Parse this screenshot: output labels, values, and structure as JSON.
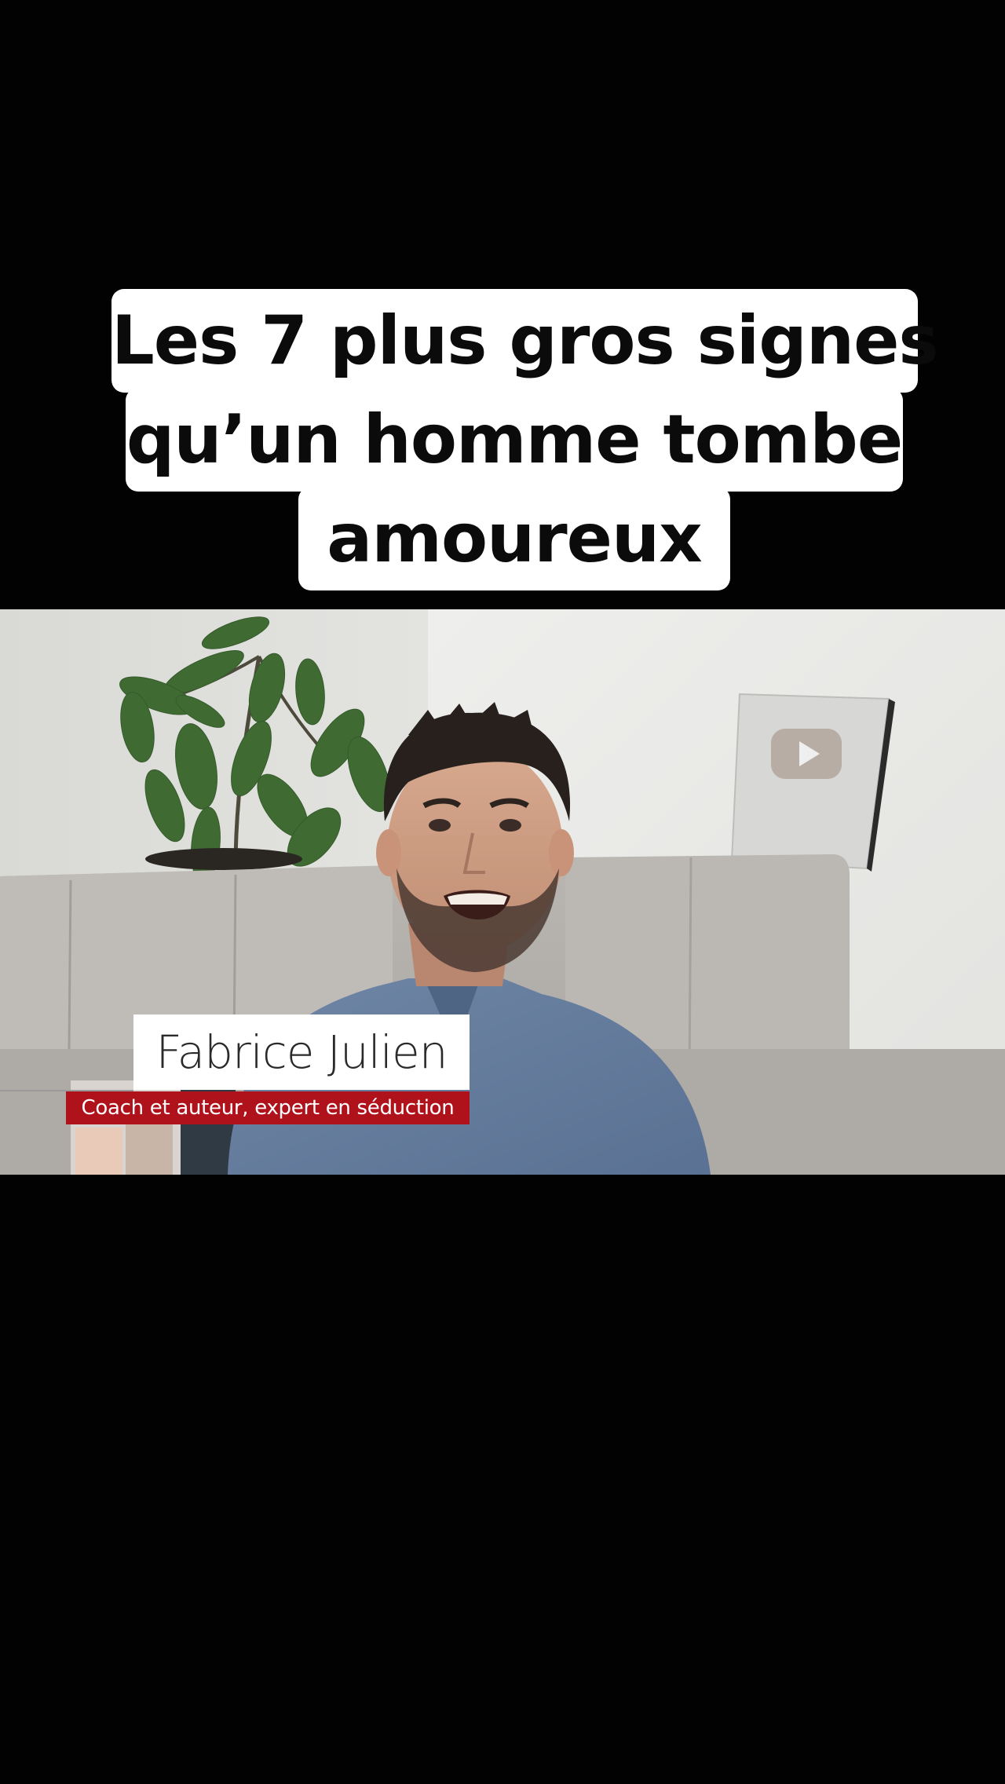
{
  "caption": {
    "line1": "Les 7 plus gros signes",
    "line2": "qu’un homme tombe",
    "line3": "amoureux"
  },
  "lower_third": {
    "name": "Fabrice Julien",
    "role": "Coach et auteur, expert en séduction"
  },
  "colors": {
    "background": "#020203",
    "caption_box": "#ffffff",
    "caption_text": "#0b0b0b",
    "role_bar": "#b0121b"
  }
}
